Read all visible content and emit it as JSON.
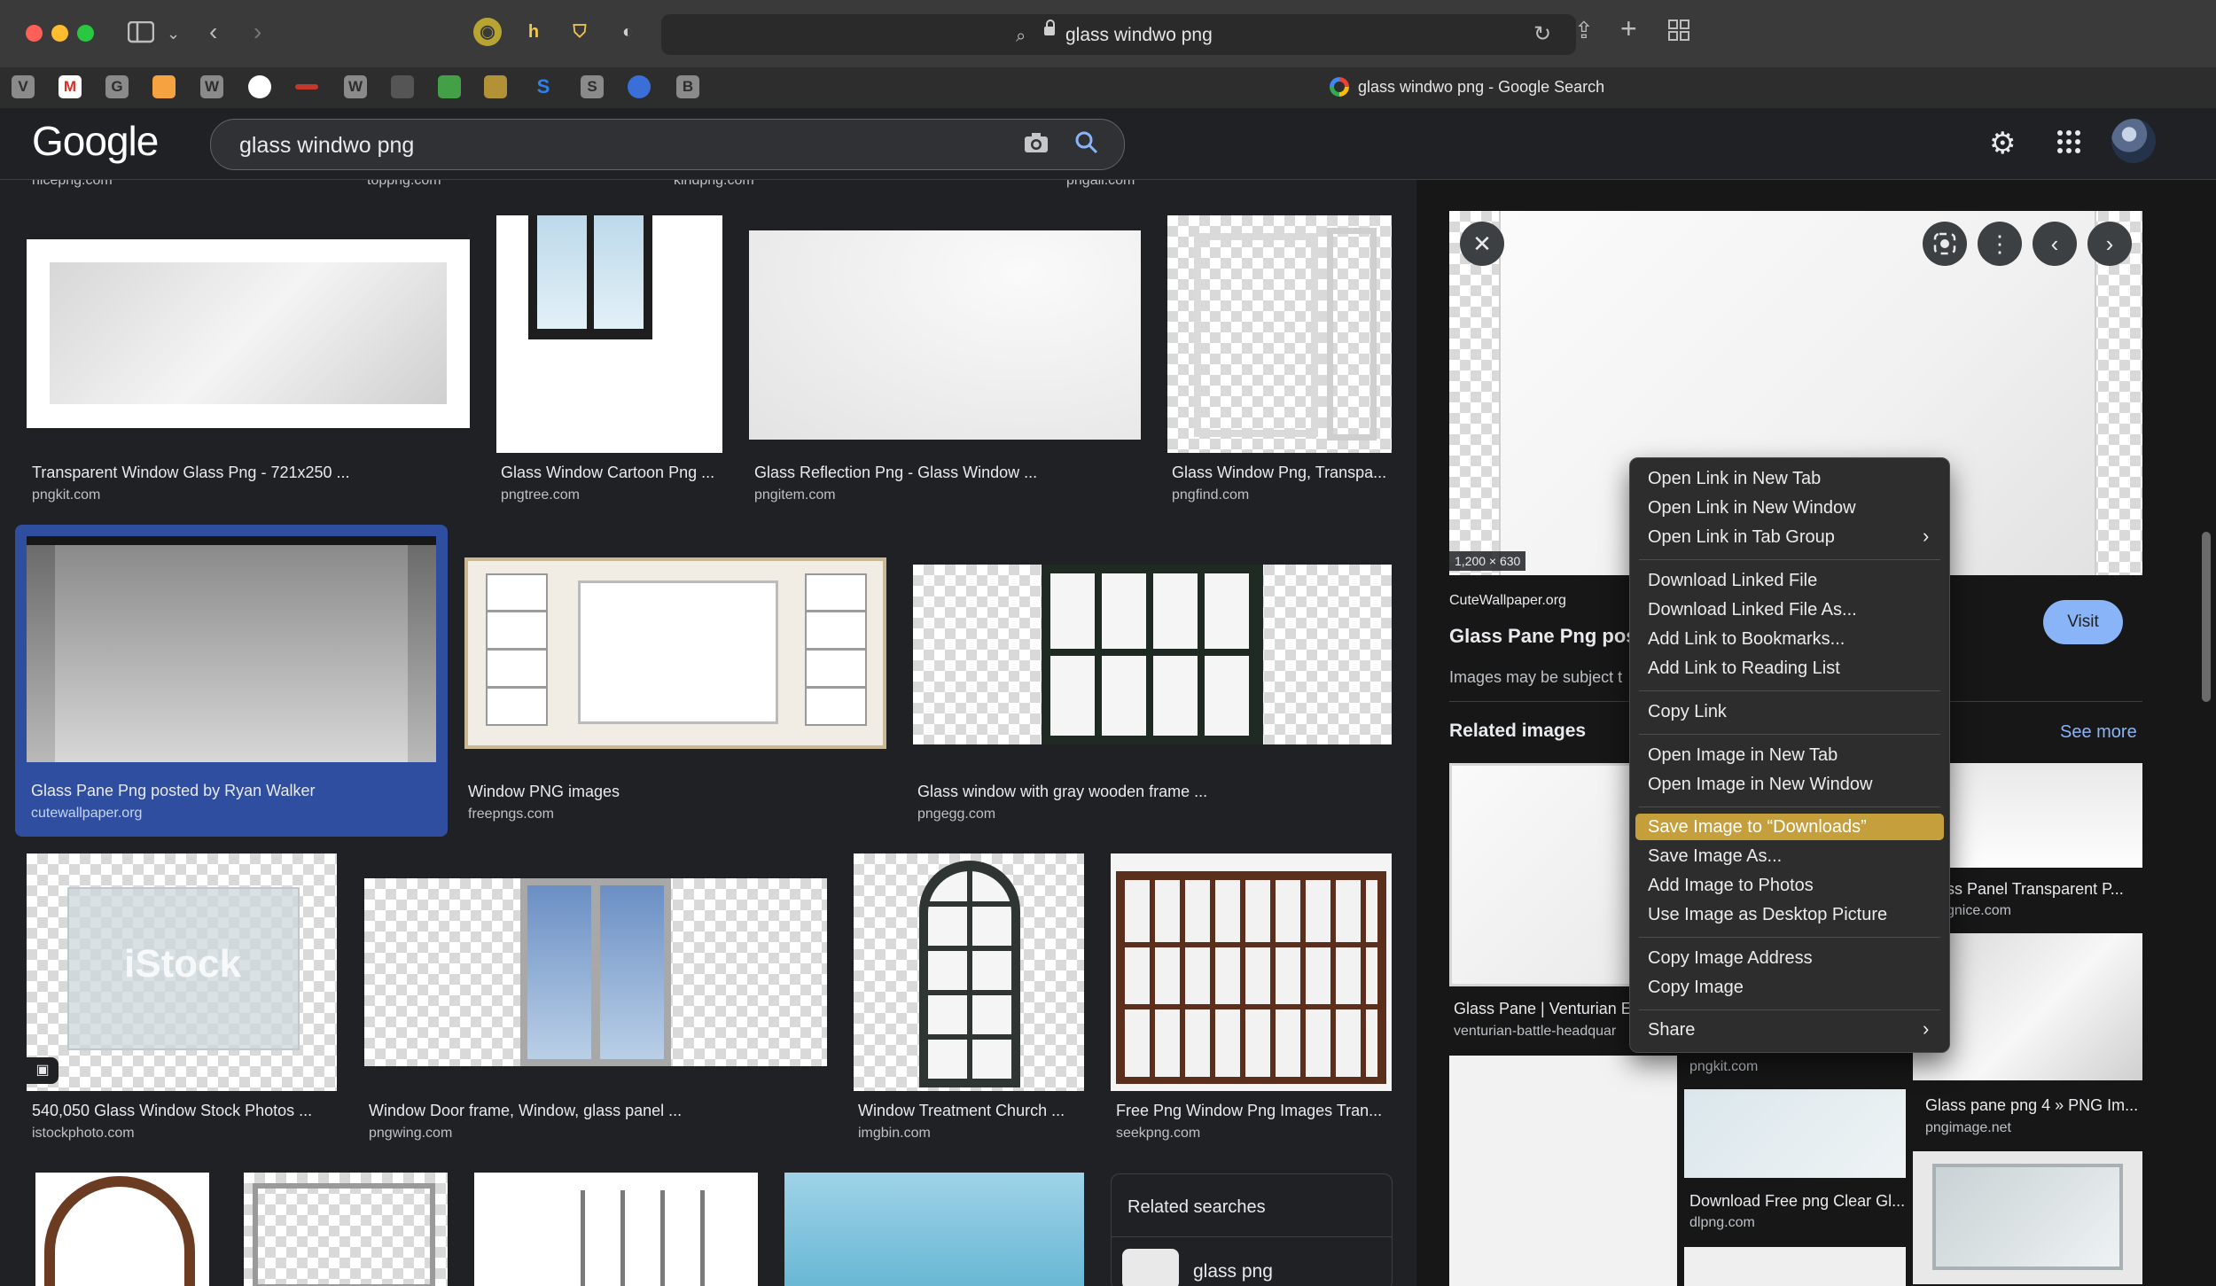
{
  "browser": {
    "url": "glass windwo png",
    "tab_title": "glass windwo png - Google Search",
    "favorites": [
      "V",
      "M",
      "G",
      "",
      "W",
      "",
      "",
      "W",
      "",
      "",
      "",
      "S",
      "S",
      "",
      "B"
    ]
  },
  "google": {
    "logo": "Google",
    "query": "glass windwo png"
  },
  "results": [
    {
      "caption": "Transparent Window Glass Png - 721x250 ...",
      "source": "pngkit.com"
    },
    {
      "caption": "Glass Window Cartoon Png ...",
      "source": "pngtree.com"
    },
    {
      "caption": "Glass Reflection Png - Glass Window ...",
      "source": "pngitem.com"
    },
    {
      "caption": "Glass Window Png, Transpa...",
      "source": "pngfind.com"
    },
    {
      "caption": "Glass Pane Png posted by Ryan Walker",
      "source": "cutewallpaper.org"
    },
    {
      "caption": "Window PNG images",
      "source": "freepngs.com"
    },
    {
      "caption": "Glass window with gray wooden frame ...",
      "source": "pngegg.com"
    },
    {
      "caption": "540,050 Glass Window Stock Photos ...",
      "source": "istockphoto.com"
    },
    {
      "caption": "Window Door frame, Window, glass panel ...",
      "source": "pngwing.com"
    },
    {
      "caption": "Window Treatment Church ...",
      "source": "imgbin.com"
    },
    {
      "caption": "Free Png Window Png Images Tran...",
      "source": "seekpng.com"
    }
  ],
  "top_row_sources": [
    "nicepng.com",
    "toppng.com",
    "kindpng.com",
    "pngall.com"
  ],
  "istock_watermark": "iStock",
  "related_searches": {
    "title": "Related searches",
    "item": "glass png"
  },
  "preview": {
    "dimensions": "1,200 × 630",
    "site": "CuteWallpaper.org",
    "title": "Glass Pane Png post",
    "notice": "Images may be subject t",
    "visit": "Visit",
    "related_heading": "Related images",
    "see_more": "See more",
    "related": [
      {
        "caption": "Glass Pane | Venturian E",
        "source": "venturian-battle-headquar"
      },
      {
        "caption": "",
        "source": "pngkit.com"
      },
      {
        "caption": "ss Panel Transparent P...",
        "source": "gnice.com"
      },
      {
        "caption": "Glass pane png 4 » PNG Im...",
        "source": "pngimage.net"
      },
      {
        "caption": "Download Free png Clear Gl...",
        "source": "dlpng.com"
      }
    ]
  },
  "context_menu": {
    "items": [
      "Open Link in New Tab",
      "Open Link in New Window",
      "Open Link in Tab Group",
      "Download Linked File",
      "Download Linked File As...",
      "Add Link to Bookmarks...",
      "Add Link to Reading List",
      "Copy Link",
      "Open Image in New Tab",
      "Open Image in New Window",
      "Save Image to “Downloads”",
      "Save Image As...",
      "Add Image to Photos",
      "Use Image as Desktop Picture",
      "Copy Image Address",
      "Copy Image",
      "Share"
    ],
    "highlighted": "Save Image to “Downloads”",
    "highlight_color": "#c59f3c"
  },
  "colors": {
    "selection": "#2f4e9f",
    "visit_button": "#8ab4f8",
    "link": "#8ab4f8"
  }
}
